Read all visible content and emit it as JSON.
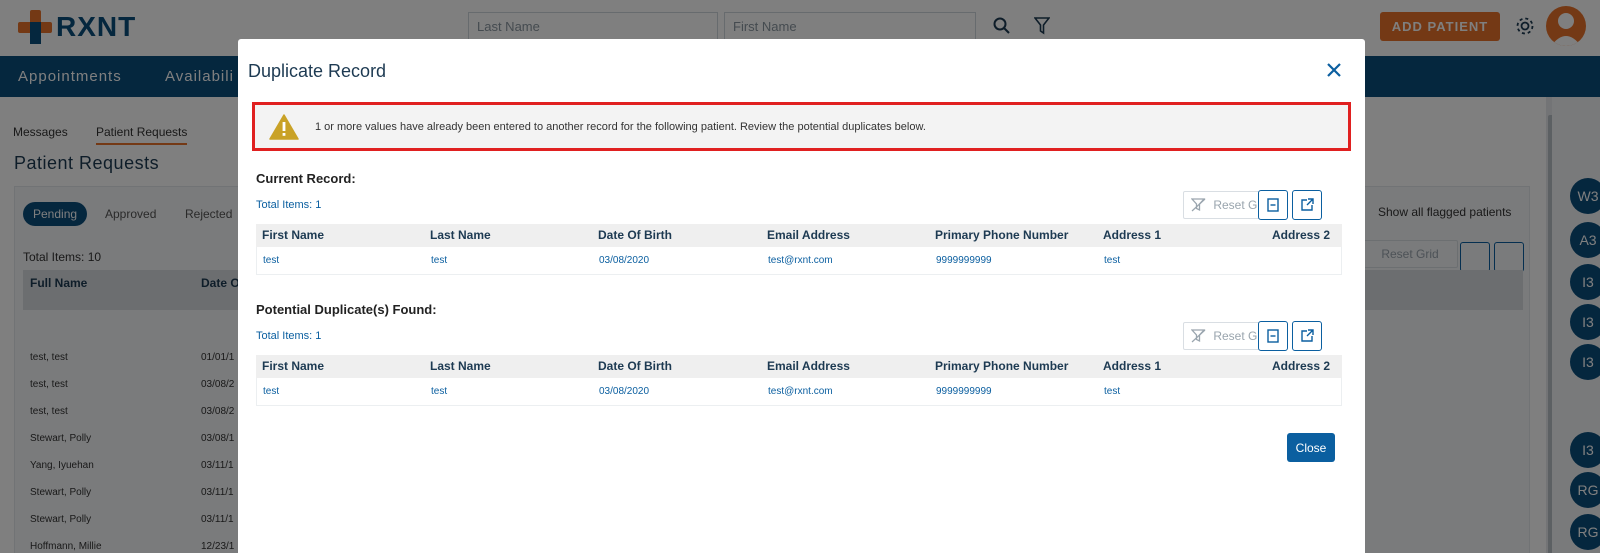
{
  "app": {
    "logo_text": "RXNT",
    "search_last_placeholder": "Last Name",
    "search_first_placeholder": "First Name",
    "add_patient_label": "ADD PATIENT",
    "nav": [
      "Appointments",
      "Availabili"
    ],
    "colors": {
      "brand_blue": "#0b4e7d",
      "accent_orange": "#e8722a",
      "alert_red": "#e02020",
      "link_blue": "#0b5fa0"
    }
  },
  "background": {
    "tabs": [
      "Messages",
      "Patient Requests"
    ],
    "title": "Patient Requests",
    "status_pills": [
      "Pending",
      "Approved",
      "Rejected"
    ],
    "total_items": "Total Items: 10",
    "show_flagged": "Show all flagged patients",
    "reset_grid": "Reset Grid",
    "columns": [
      "Full Name",
      "Date O"
    ],
    "rows": [
      {
        "name": "test, test",
        "date": "01/01/1"
      },
      {
        "name": "test, test",
        "date": "03/08/2"
      },
      {
        "name": "test, test",
        "date": "03/08/2"
      },
      {
        "name": "Stewart, Polly",
        "date": "03/08/1"
      },
      {
        "name": "Yang, Iyuehan",
        "date": "03/11/1"
      },
      {
        "name": "Stewart, Polly",
        "date": "03/11/1"
      },
      {
        "name": "Stewart, Polly",
        "date": "03/11/1"
      },
      {
        "name": "Hoffmann, Millie",
        "date": "12/23/1"
      }
    ],
    "side_avatars": [
      "W3",
      "A3",
      "I3",
      "I3",
      "I3",
      "I3",
      "RG",
      "RG"
    ]
  },
  "modal": {
    "title": "Duplicate Record",
    "alert_text": "1 or more values have already been entered to another record for the following patient. Review the potential duplicates below.",
    "current_title": "Current Record:",
    "current_total": "Total Items: 1",
    "duplicate_title": "Potential Duplicate(s) Found:",
    "duplicate_total": "Total Items: 1",
    "reset_grid": "Reset Grid",
    "columns": [
      "First Name",
      "Last Name",
      "Date Of Birth",
      "Email Address",
      "Primary Phone Number",
      "Address 1",
      "Address 2"
    ],
    "current_row": [
      "test",
      "test",
      "03/08/2020",
      "test@rxnt.com",
      "9999999999",
      "test",
      ""
    ],
    "duplicate_row": [
      "test",
      "test",
      "03/08/2020",
      "test@rxnt.com",
      "9999999999",
      "test",
      ""
    ],
    "close_label": "Close"
  }
}
